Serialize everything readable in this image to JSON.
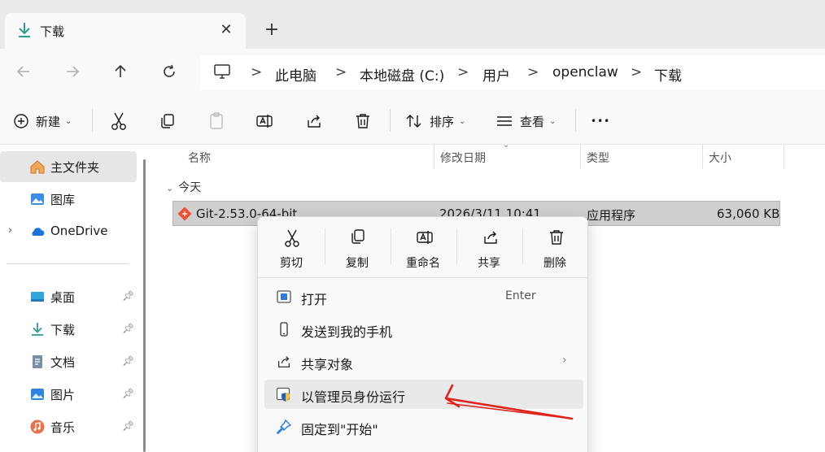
{
  "tab": {
    "title": "下载",
    "close_glyph": "✕",
    "new_tab_glyph": "+"
  },
  "nav": {
    "back_icon": "arrow-left-icon",
    "forward_icon": "arrow-right-icon",
    "up_icon": "arrow-up-icon",
    "refresh_icon": "refresh-icon",
    "breadcrumbs": [
      "此电脑",
      "本地磁盘 (C:)",
      "用户",
      "openclaw",
      "下载"
    ],
    "separator": ">"
  },
  "toolbar": {
    "new_label": "新建",
    "sort_label": "排序",
    "view_label": "查看",
    "more_glyph": "•••",
    "caret": "⌄"
  },
  "sidebar": {
    "items": [
      {
        "label": "主文件夹",
        "icon": "home-icon",
        "selected": true
      },
      {
        "label": "图库",
        "icon": "gallery-icon"
      },
      {
        "label": "OneDrive",
        "icon": "cloud-icon",
        "expandable": true
      },
      {
        "label": "桌面",
        "icon": "desktop-icon",
        "pinned": true
      },
      {
        "label": "下载",
        "icon": "download-icon",
        "pinned": true
      },
      {
        "label": "文档",
        "icon": "document-icon",
        "pinned": true
      },
      {
        "label": "图片",
        "icon": "picture-icon",
        "pinned": true
      },
      {
        "label": "音乐",
        "icon": "music-icon",
        "pinned": true
      }
    ],
    "pin_glyph": "📌",
    "expand_glyph": "›"
  },
  "list": {
    "columns": [
      "名称",
      "修改日期",
      "类型",
      "大小"
    ],
    "sort_caret": "⌄",
    "group_label": "今天",
    "group_toggle": "⌄",
    "files": [
      {
        "name": "Git-2.53.0-64-bit",
        "date": "2026/3/11 10:41",
        "type": "应用程序",
        "size": "63,060 KB",
        "icon": "git-icon"
      }
    ]
  },
  "context_menu": {
    "quick_actions": [
      {
        "label": "剪切",
        "icon": "scissors-icon"
      },
      {
        "label": "复制",
        "icon": "copy-icon"
      },
      {
        "label": "重命名",
        "icon": "rename-icon"
      },
      {
        "label": "共享",
        "icon": "share-icon"
      },
      {
        "label": "删除",
        "icon": "trash-icon"
      }
    ],
    "items": [
      {
        "label": "打开",
        "shortcut": "Enter",
        "icon": "app-window-icon"
      },
      {
        "label": "发送到我的手机",
        "icon": "phone-icon"
      },
      {
        "label": "共享对象",
        "icon": "share-icon",
        "submenu_glyph": "›"
      },
      {
        "label": "以管理员身份运行",
        "icon": "shield-icon",
        "highlighted": true
      },
      {
        "label": "固定到\"开始\"",
        "icon": "pin-icon"
      }
    ]
  },
  "colors": {
    "accent": "#0067c0",
    "annotation": "#e0241a",
    "selection": "#cfcfd0"
  }
}
